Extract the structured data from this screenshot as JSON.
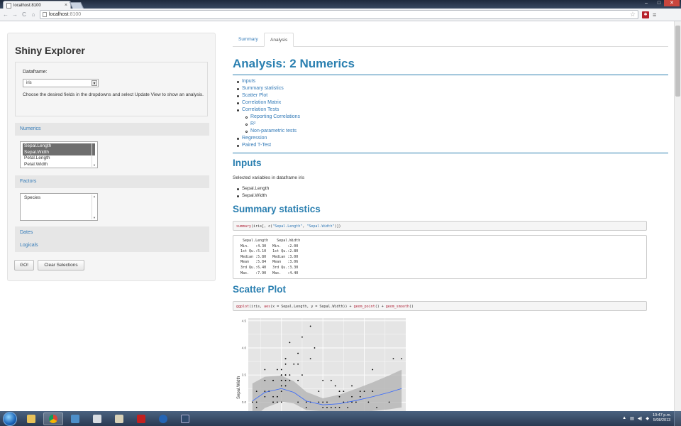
{
  "browser": {
    "tab_title": "localhost:8100",
    "tab_close": "×",
    "url_host": "localhost",
    "url_port": ":8100",
    "back_icon": "←",
    "forward_icon": "→",
    "reload_icon": "C",
    "home_icon": "⌂",
    "star_icon": "☆",
    "menu_icon": "≡",
    "extension_icon": "✱",
    "min_icon": "–",
    "max_icon": "□",
    "close_icon": "✕"
  },
  "sidebar": {
    "title": "Shiny Explorer",
    "dataframe_label": "Dataframe:",
    "dataframe_value": "iris",
    "help_text": "Choose the desired fields in the dropdowns and select Update View to show an analysis.",
    "sections": {
      "numerics": "Numerics",
      "factors": "Factors",
      "dates": "Dates",
      "logicals": "Logicals"
    },
    "numerics_options": [
      {
        "label": "Sepal.Length",
        "selected": true
      },
      {
        "label": "Sepal.Width",
        "selected": true
      },
      {
        "label": "Petal.Length",
        "selected": false
      },
      {
        "label": "Petal.Width",
        "selected": false
      }
    ],
    "factors_options": [
      {
        "label": "Species",
        "selected": false
      }
    ],
    "go_button": "GO!",
    "clear_button": "Clear Selections"
  },
  "main": {
    "tabs": [
      {
        "label": "Summary"
      },
      {
        "label": "Analysis"
      }
    ],
    "active_tab": "Analysis",
    "title": "Analysis: 2 Numerics",
    "toc": [
      "Inputs",
      "Summary statistics",
      "Scatter Plot",
      "Correlation Matrix",
      "Correlation Tests"
    ],
    "toc_sub": [
      "Reporting Correlations",
      "R²",
      "Non-parametric tests"
    ],
    "toc_after": [
      "Regression",
      "Paired T-Test"
    ],
    "inputs_heading": "Inputs",
    "inputs_text": "Selected variables in dataframe iris",
    "input_vars": [
      "Sepal.Length",
      "Sepal.Width"
    ],
    "summary_heading": "Summary statistics",
    "summary_code": {
      "fn": "summary",
      "args1": "(iris[, c(",
      "s1": "\"Sepal.Length\"",
      "comma": ", ",
      "s2": "\"Sepal.Width\"",
      "end": ")])"
    },
    "summary_output": "  Sepal.Length    Sepal.Width   \n Min.   :4.30   Min.   :2.00  \n 1st Qu.:5.10   1st Qu.:2.80  \n Median :5.80   Median :3.00  \n Mean   :5.84   Mean   :3.06  \n 3rd Qu.:6.40   3rd Qu.:3.30  \n Max.   :7.90   Max.   :4.40  ",
    "scatter_heading": "Scatter Plot",
    "scatter_code": {
      "fn1": "ggplot",
      "a1": "(iris, ",
      "fn2": "aes",
      "a2": "(x = Sepal.Length, y = Sepal.Width)) + ",
      "fn3": "geom_point",
      "a3": "() + ",
      "fn4": "geom_smooth",
      "a4": "()"
    }
  },
  "chart_data": {
    "type": "scatter",
    "ylabel": "Sepal.Width",
    "yticks": [
      "4.5",
      "4.0",
      "3.5",
      "3.0"
    ],
    "xlim": [
      4.2,
      8.0
    ],
    "ylim": [
      2.9,
      4.55
    ],
    "points": [
      [
        4.3,
        3.0
      ],
      [
        4.4,
        3.2
      ],
      [
        4.4,
        3.0
      ],
      [
        4.4,
        2.9
      ],
      [
        4.5,
        2.3
      ],
      [
        4.6,
        3.1
      ],
      [
        4.6,
        3.4
      ],
      [
        4.6,
        3.6
      ],
      [
        4.6,
        3.2
      ],
      [
        4.7,
        3.2
      ],
      [
        4.7,
        3.2
      ],
      [
        4.8,
        3.4
      ],
      [
        4.8,
        3.0
      ],
      [
        4.8,
        3.4
      ],
      [
        4.8,
        3.1
      ],
      [
        4.8,
        3.0
      ],
      [
        4.9,
        3.0
      ],
      [
        4.9,
        3.1
      ],
      [
        4.9,
        3.1
      ],
      [
        4.9,
        3.6
      ],
      [
        5.0,
        3.6
      ],
      [
        5.0,
        3.4
      ],
      [
        5.0,
        3.0
      ],
      [
        5.0,
        3.4
      ],
      [
        5.0,
        3.2
      ],
      [
        5.0,
        3.5
      ],
      [
        5.0,
        3.5
      ],
      [
        5.0,
        3.3
      ],
      [
        5.1,
        3.5
      ],
      [
        5.1,
        3.5
      ],
      [
        5.1,
        3.8
      ],
      [
        5.1,
        3.7
      ],
      [
        5.1,
        3.3
      ],
      [
        5.1,
        3.4
      ],
      [
        5.1,
        3.8
      ],
      [
        5.1,
        3.8
      ],
      [
        5.2,
        3.5
      ],
      [
        5.2,
        3.4
      ],
      [
        5.2,
        4.1
      ],
      [
        5.2,
        2.7
      ],
      [
        5.3,
        3.7
      ],
      [
        5.4,
        3.9
      ],
      [
        5.4,
        3.7
      ],
      [
        5.4,
        3.9
      ],
      [
        5.4,
        3.4
      ],
      [
        5.4,
        3.4
      ],
      [
        5.4,
        3.0
      ],
      [
        5.5,
        4.2
      ],
      [
        5.5,
        3.5
      ],
      [
        5.5,
        2.4
      ],
      [
        5.6,
        2.9
      ],
      [
        5.6,
        3.0
      ],
      [
        5.7,
        4.4
      ],
      [
        5.7,
        3.8
      ],
      [
        5.7,
        3.0
      ],
      [
        5.7,
        2.8
      ],
      [
        5.8,
        4.0
      ],
      [
        5.8,
        2.7
      ],
      [
        5.8,
        2.7
      ],
      [
        5.9,
        3.0
      ],
      [
        5.9,
        3.2
      ],
      [
        6.0,
        2.2
      ],
      [
        6.0,
        2.9
      ],
      [
        6.0,
        3.4
      ],
      [
        6.0,
        3.0
      ],
      [
        6.1,
        2.9
      ],
      [
        6.1,
        3.0
      ],
      [
        6.1,
        2.8
      ],
      [
        6.2,
        2.9
      ],
      [
        6.2,
        3.4
      ],
      [
        6.3,
        3.3
      ],
      [
        6.3,
        2.5
      ],
      [
        6.3,
        2.9
      ],
      [
        6.4,
        3.2
      ],
      [
        6.4,
        2.9
      ],
      [
        6.4,
        3.2
      ],
      [
        6.4,
        3.1
      ],
      [
        6.5,
        3.0
      ],
      [
        6.5,
        2.8
      ],
      [
        6.5,
        3.2
      ],
      [
        6.6,
        2.9
      ],
      [
        6.6,
        3.0
      ],
      [
        6.7,
        3.1
      ],
      [
        6.7,
        3.0
      ],
      [
        6.7,
        3.3
      ],
      [
        6.8,
        2.8
      ],
      [
        6.8,
        3.0
      ],
      [
        6.9,
        3.1
      ],
      [
        6.9,
        3.2
      ],
      [
        7.0,
        3.2
      ],
      [
        7.1,
        3.0
      ],
      [
        7.2,
        3.6
      ],
      [
        7.2,
        3.2
      ],
      [
        7.3,
        2.9
      ],
      [
        7.4,
        2.8
      ],
      [
        7.6,
        3.0
      ],
      [
        7.7,
        3.8
      ],
      [
        7.7,
        2.6
      ],
      [
        7.7,
        2.8
      ],
      [
        7.9,
        3.8
      ]
    ],
    "smooth": [
      [
        4.3,
        3.02
      ],
      [
        4.6,
        3.18
      ],
      [
        5.0,
        3.25
      ],
      [
        5.3,
        3.18
      ],
      [
        5.6,
        3.02
      ],
      [
        6.0,
        2.95
      ],
      [
        6.4,
        2.97
      ],
      [
        6.8,
        3.03
      ],
      [
        7.2,
        3.1
      ],
      [
        7.6,
        3.18
      ],
      [
        7.9,
        3.25
      ]
    ]
  },
  "taskbar": {
    "clock_time": "10:47 p.m.",
    "clock_date": "5/08/2013",
    "tray_up": "▲"
  },
  "colors": {
    "accent": "#2a7fb0",
    "link": "#337ab7",
    "code_fn": "#b0273b"
  }
}
